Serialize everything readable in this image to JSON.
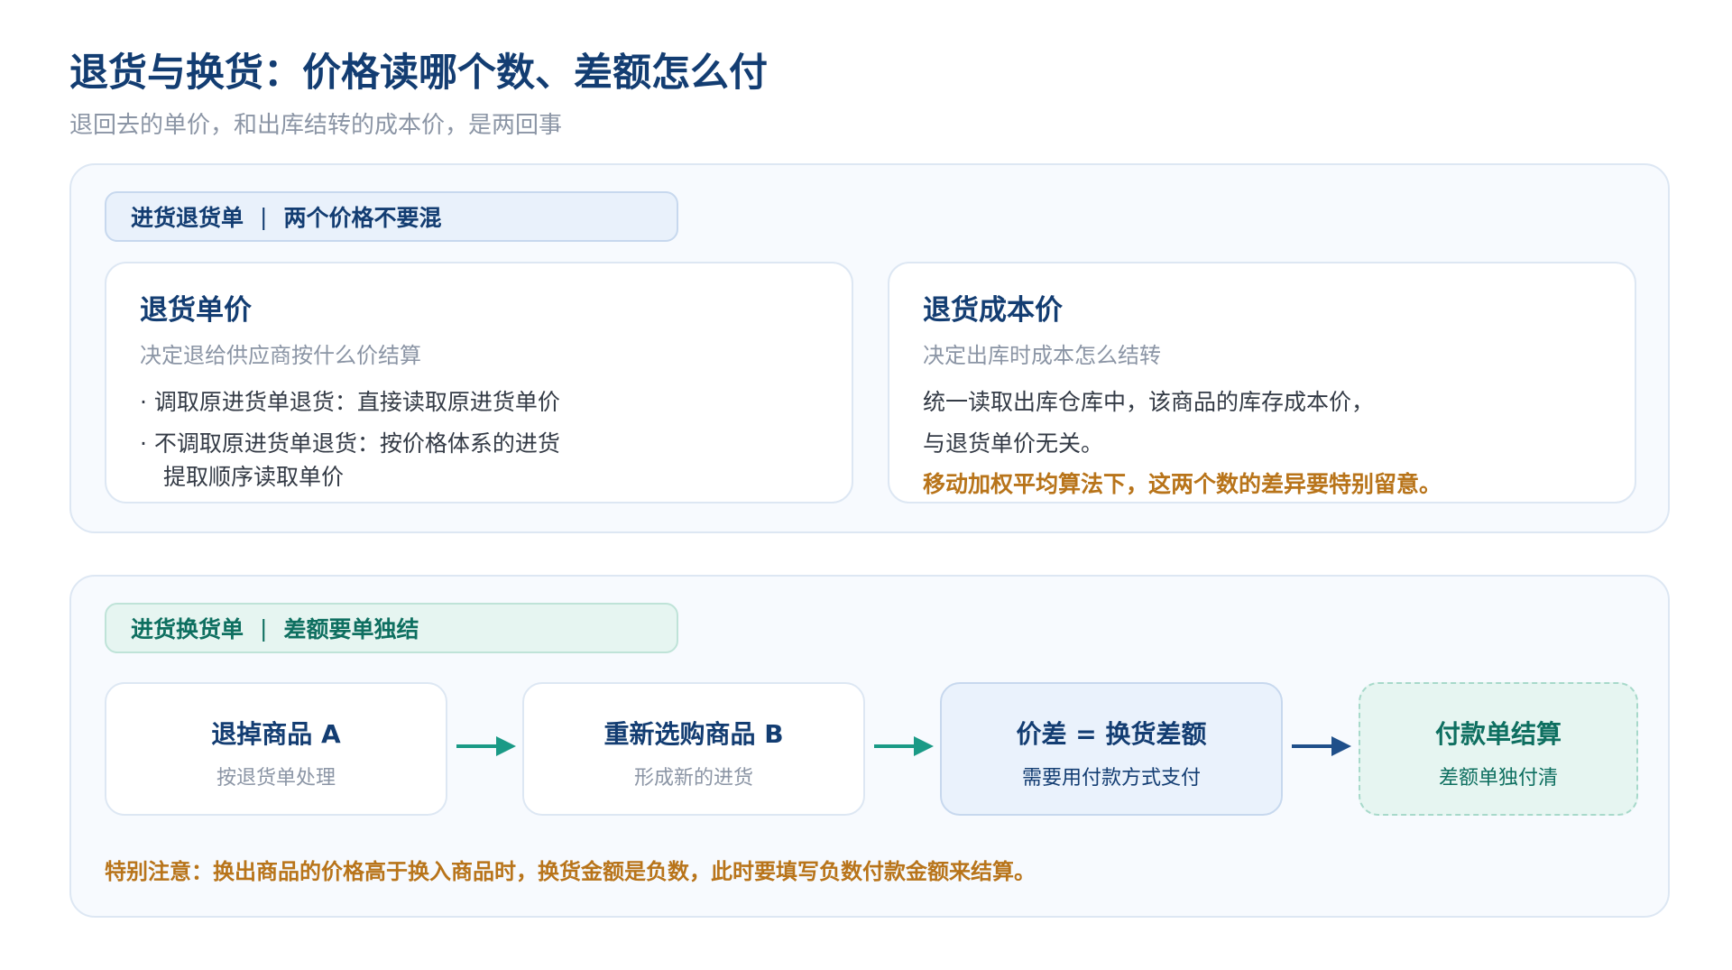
{
  "header": {
    "title": "退货与换货：价格读哪个数、差额怎么付",
    "subtitle": "退回去的单价，和出库结转的成本价，是两回事"
  },
  "return_section": {
    "tag": "进货退货单",
    "tag_separator": "|",
    "tag_note": "两个价格不要混",
    "cards": [
      {
        "title": "退货单价",
        "subtitle": "决定退给供应商按什么价结算",
        "lines": [
          "· 调取原进货单退货：直接读取原进货单价",
          "· 不调取原进货单退货：按价格体系的进货",
          "提取顺序读取单价"
        ]
      },
      {
        "title": "退货成本价",
        "subtitle": "决定出库时成本怎么结转",
        "lines": [
          "统一读取出库仓库中，该商品的库存成本价，",
          "与退货单价无关。"
        ],
        "warning": "移动加权平均算法下，这两个数的差异要特别留意。"
      }
    ]
  },
  "exchange_section": {
    "tag": "进货换货单",
    "tag_separator": "|",
    "tag_note": "差额要单独结",
    "steps": [
      {
        "title": "退掉商品 A",
        "subtitle": "按退货单处理"
      },
      {
        "title": "重新选购商品 B",
        "subtitle": "形成新的进货"
      },
      {
        "title": "价差 = 换货差额",
        "subtitle": "需要用付款方式支付"
      },
      {
        "title": "付款单结算",
        "subtitle": "差额单独付清"
      }
    ],
    "note": "特别注意：换出商品的价格高于换入商品时，换货金额是负数，此时要填写负数付款金额来结算。"
  },
  "colors": {
    "title_navy": "#133d72",
    "muted_gray": "#8b95a5",
    "teal": "#1a9a86",
    "navy_arrow": "#1f4f8a",
    "warning_amber": "#b8741a",
    "panel_bg": "#f7fafe"
  }
}
